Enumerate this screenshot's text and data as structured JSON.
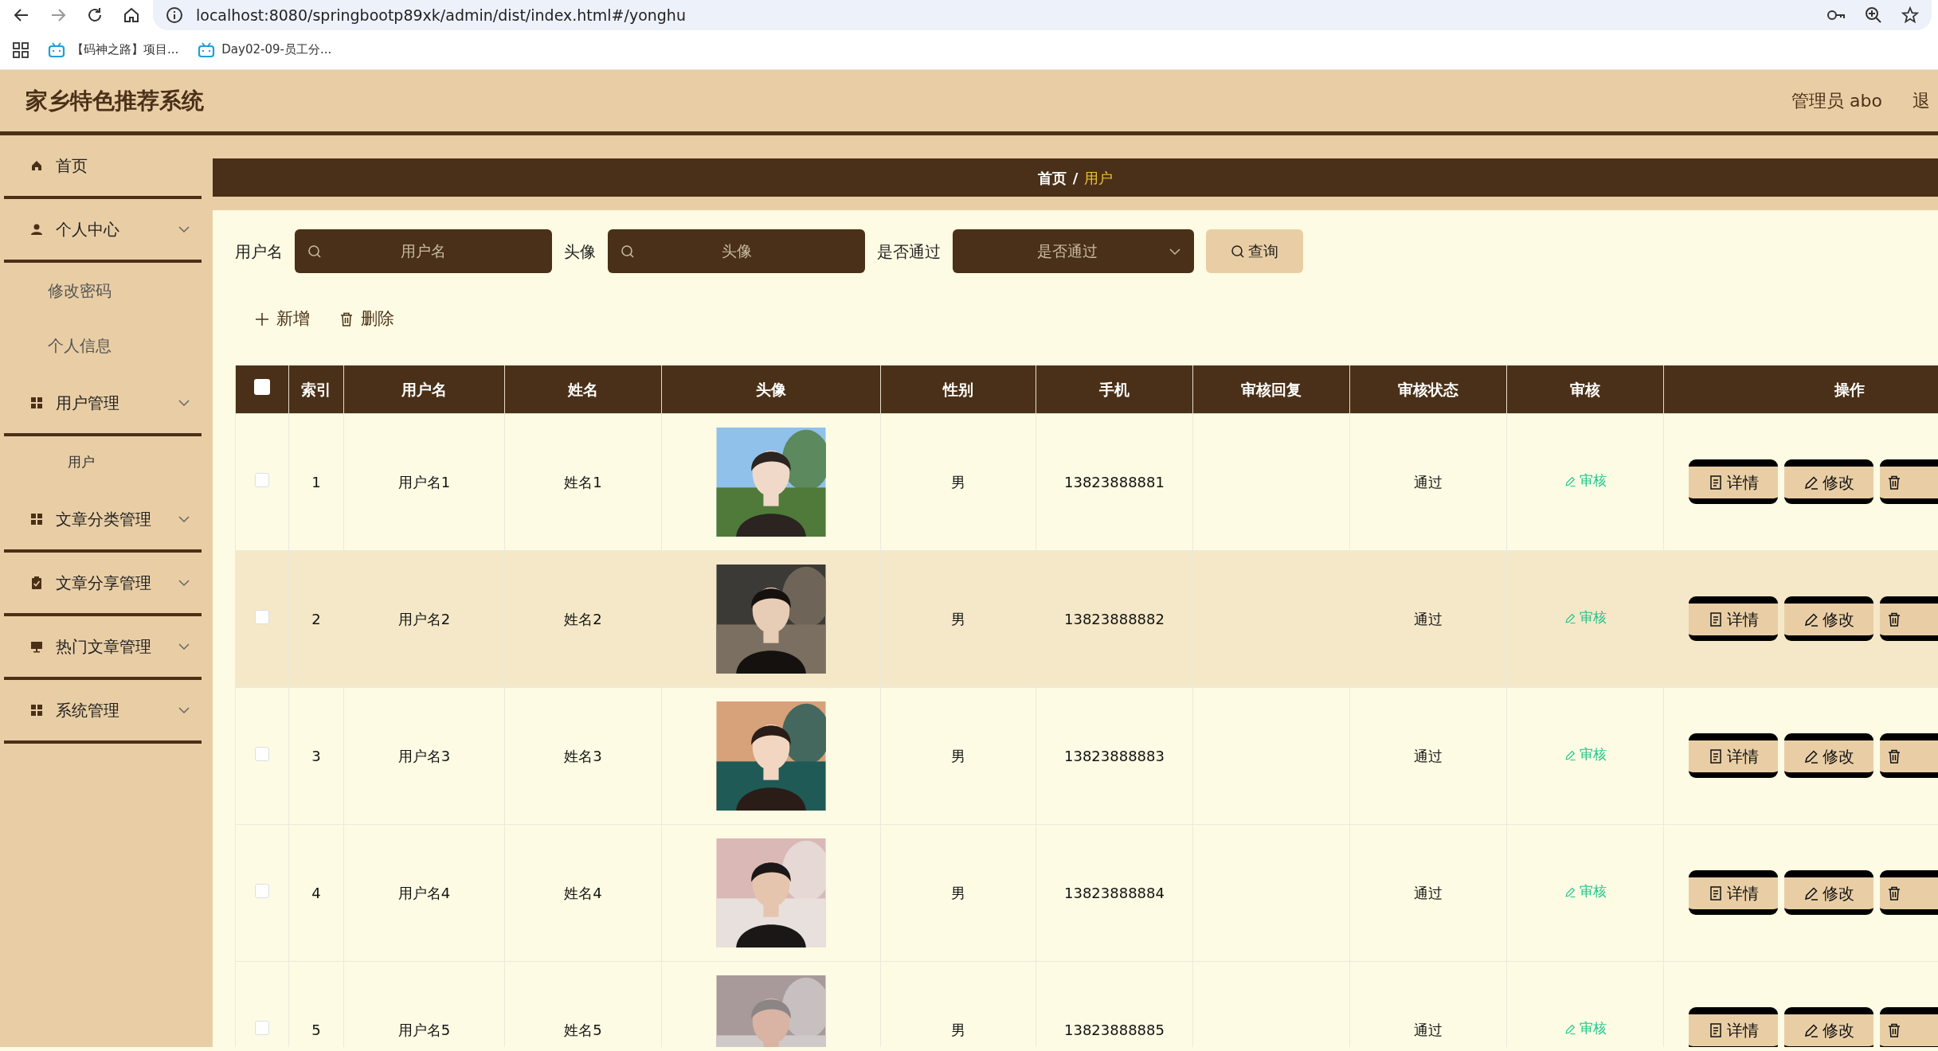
{
  "browser": {
    "url": "localhost:8080/springbootp89xk/admin/dist/index.html#/yonghu",
    "bookmarks": [
      {
        "label": "【码神之路】项目..."
      },
      {
        "label": "Day02-09-员工分..."
      }
    ]
  },
  "header": {
    "title": "家乡特色推荐系统",
    "user": "管理员 abo",
    "logout": "退"
  },
  "sidebar": {
    "items": [
      {
        "label": "首页",
        "kind": "link"
      },
      {
        "label": "个人中心",
        "kind": "submenu",
        "children": [
          {
            "label": "修改密码",
            "selected": false
          },
          {
            "label": "个人信息",
            "selected": false
          }
        ]
      },
      {
        "label": "用户管理",
        "kind": "submenu",
        "children": [
          {
            "label": "用户",
            "selected": true
          }
        ]
      },
      {
        "label": "文章分类管理",
        "kind": "submenu"
      },
      {
        "label": "文章分享管理",
        "kind": "submenu"
      },
      {
        "label": "热门文章管理",
        "kind": "submenu"
      },
      {
        "label": "系统管理",
        "kind": "submenu"
      }
    ]
  },
  "breadcrumb": {
    "separator": "/",
    "items": [
      {
        "label": "首页",
        "current": false
      },
      {
        "label": "用户",
        "current": true
      }
    ]
  },
  "search": {
    "fields": [
      {
        "label": "用户名",
        "placeholder": "用户名",
        "kind": "input"
      },
      {
        "label": "头像",
        "placeholder": "头像",
        "kind": "input"
      },
      {
        "label": "是否通过",
        "placeholder": "是否通过",
        "kind": "select"
      }
    ],
    "button": "查询"
  },
  "actions": [
    {
      "label": "新增"
    },
    {
      "label": "删除"
    }
  ],
  "table": {
    "select_all_checked": false,
    "columns": [
      "索引",
      "用户名",
      "姓名",
      "头像",
      "性别",
      "手机",
      "审核回复",
      "审核状态",
      "审核",
      "操作"
    ],
    "rows": [
      {
        "selected": false,
        "highlighted": false,
        "index": "1",
        "username": "用户名1",
        "name": "姓名1",
        "avatar": {
          "kind": "picture"
        },
        "gender": "男",
        "phone": "13823888881",
        "status": "通过",
        "review": "审核",
        "buttons": [
          {
            "label": "详情"
          },
          {
            "label": "修改"
          }
        ]
      },
      {
        "selected": false,
        "highlighted": true,
        "index": "2",
        "username": "用户名2",
        "name": "姓名2",
        "avatar": {
          "kind": "picture"
        },
        "gender": "男",
        "phone": "13823888882",
        "status": "通过",
        "review": "审核",
        "buttons": [
          {
            "label": "详情"
          },
          {
            "label": "修改"
          }
        ]
      },
      {
        "selected": false,
        "highlighted": false,
        "index": "3",
        "username": "用户名3",
        "name": "姓名3",
        "avatar": {
          "kind": "picture"
        },
        "gender": "男",
        "phone": "13823888883",
        "status": "通过",
        "review": "审核",
        "buttons": [
          {
            "label": "详情"
          },
          {
            "label": "修改"
          }
        ]
      },
      {
        "selected": false,
        "highlighted": false,
        "index": "4",
        "username": "用户名4",
        "name": "姓名4",
        "avatar": {
          "kind": "picture"
        },
        "gender": "男",
        "phone": "13823888884",
        "status": "通过",
        "review": "审核",
        "buttons": [
          {
            "label": "详情"
          },
          {
            "label": "修改"
          }
        ]
      },
      {
        "selected": false,
        "highlighted": false,
        "index": "5",
        "username": "用户名5",
        "name": "姓名5",
        "avatar": {
          "kind": "picture"
        },
        "gender": "男",
        "phone": "13823888885",
        "status": "通过",
        "review": "审核",
        "buttons": [
          {
            "label": "详情"
          },
          {
            "label": "修改"
          }
        ]
      }
    ]
  }
}
